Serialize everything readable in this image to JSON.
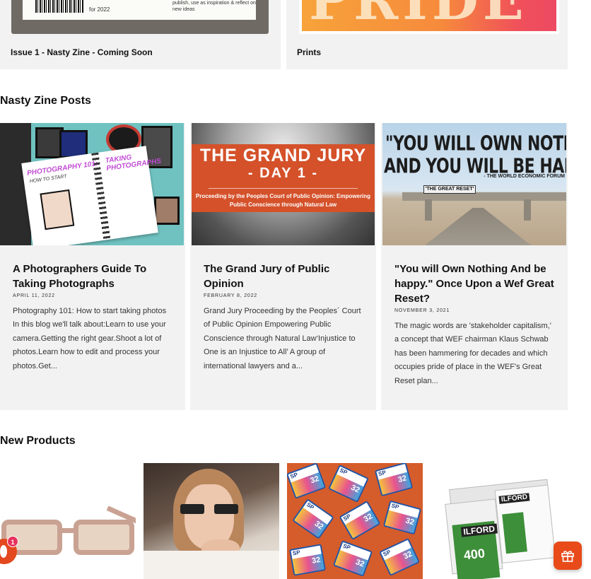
{
  "featured": [
    {
      "title": "Issue 1 - Nasty Zine - Coming Soon",
      "image_text": {
        "year": "for 2022",
        "note": "publish, use as inspiration & reflect on new ideas"
      }
    },
    {
      "title": "Prints",
      "image_text": {
        "word": "PRIDE"
      }
    }
  ],
  "posts_section": {
    "heading": "Nasty Zine Posts",
    "posts": [
      {
        "title": "A Photographers Guide To Taking Photographs",
        "date": "APRIL 11, 2022",
        "excerpt": "Photography 101: How to start taking photos In this blog we'll talk about:Learn to use your camera.Getting the right gear.Shoot a lot of photos.Learn how to edit and process your photos.Get...",
        "image_text": {
          "t1": "PHOTOGRAPHY 101:",
          "t2": "HOW TO START",
          "t3": "TAKING PHOTOGRAPHS"
        }
      },
      {
        "title": "The Grand Jury of Public Opinion",
        "date": "FEBRUARY 8, 2022",
        "excerpt": "Grand Jury Proceeding by the Peoples´ Court of Public Opinion Empowering Public Conscience through Natural Law‘Injustice to One is an Injustice to All’   A group of international lawyers and a...",
        "image_text": {
          "h1": "THE GRAND JURY",
          "h2": "- DAY 1 -",
          "sub": "Proceeding by the Peoples Court of Public Opinion: Empowering Public Conscience through Natural Law"
        }
      },
      {
        "title": "\"You will Own Nothing And be happy.\" Once Upon a Wef Great Reset?",
        "date": "NOVEMBER 3, 2021",
        "excerpt": "The magic words are 'stakeholder capitalism,' a concept that WEF chairman Klaus Schwab has been hammering for decades and which occupies pride of place in the WEF's Great Reset plan...",
        "image_text": {
          "q1": "\"YOU WILL OWN NOTHING,",
          "q2": "AND YOU WILL BE HAPPY.\"",
          "source": "- THE WORLD ECONOMIC FORUM",
          "sign": "'THE GREAT RESET'"
        }
      }
    ]
  },
  "products_section": {
    "heading": "New Products",
    "image_text": {
      "sd_label": "SP",
      "sd_size": "32",
      "film_brand": "ILFORD",
      "film_iso": "400"
    }
  },
  "chat_widget": {
    "badge_count": "1"
  },
  "colors": {
    "card_bg": "#f2f2f2",
    "accent": "#e84a1a",
    "badge": "#e6325d"
  },
  "icons": {
    "chat": "chat-icon",
    "gift": "gift-icon"
  }
}
